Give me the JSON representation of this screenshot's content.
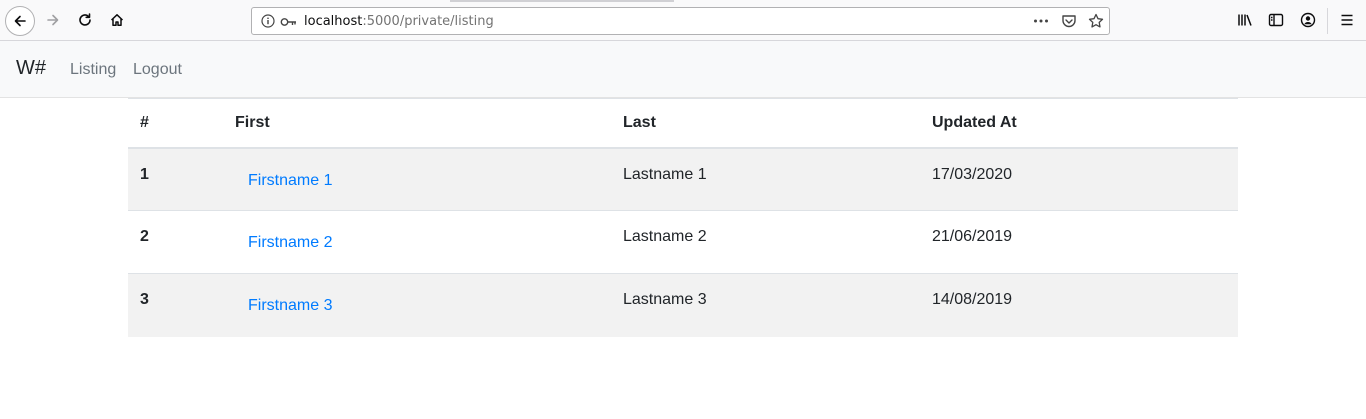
{
  "browser": {
    "url_host": "localhost",
    "url_path": ":5000/private/listing"
  },
  "navbar": {
    "brand": "W#",
    "links": [
      "Listing",
      "Logout"
    ]
  },
  "table": {
    "headers": [
      "#",
      "First",
      "Last",
      "Updated At"
    ],
    "rows": [
      {
        "id": "1",
        "first": "Firstname 1",
        "last": "Lastname 1",
        "updated": "17/03/2020"
      },
      {
        "id": "2",
        "first": "Firstname 2",
        "last": "Lastname 2",
        "updated": "21/06/2019"
      },
      {
        "id": "3",
        "first": "Firstname 3",
        "last": "Lastname 3",
        "updated": "14/08/2019"
      }
    ]
  },
  "colors": {
    "link": "#007bff",
    "stripe": "#f2f2f2",
    "navbar_bg": "#f8f9fa"
  }
}
